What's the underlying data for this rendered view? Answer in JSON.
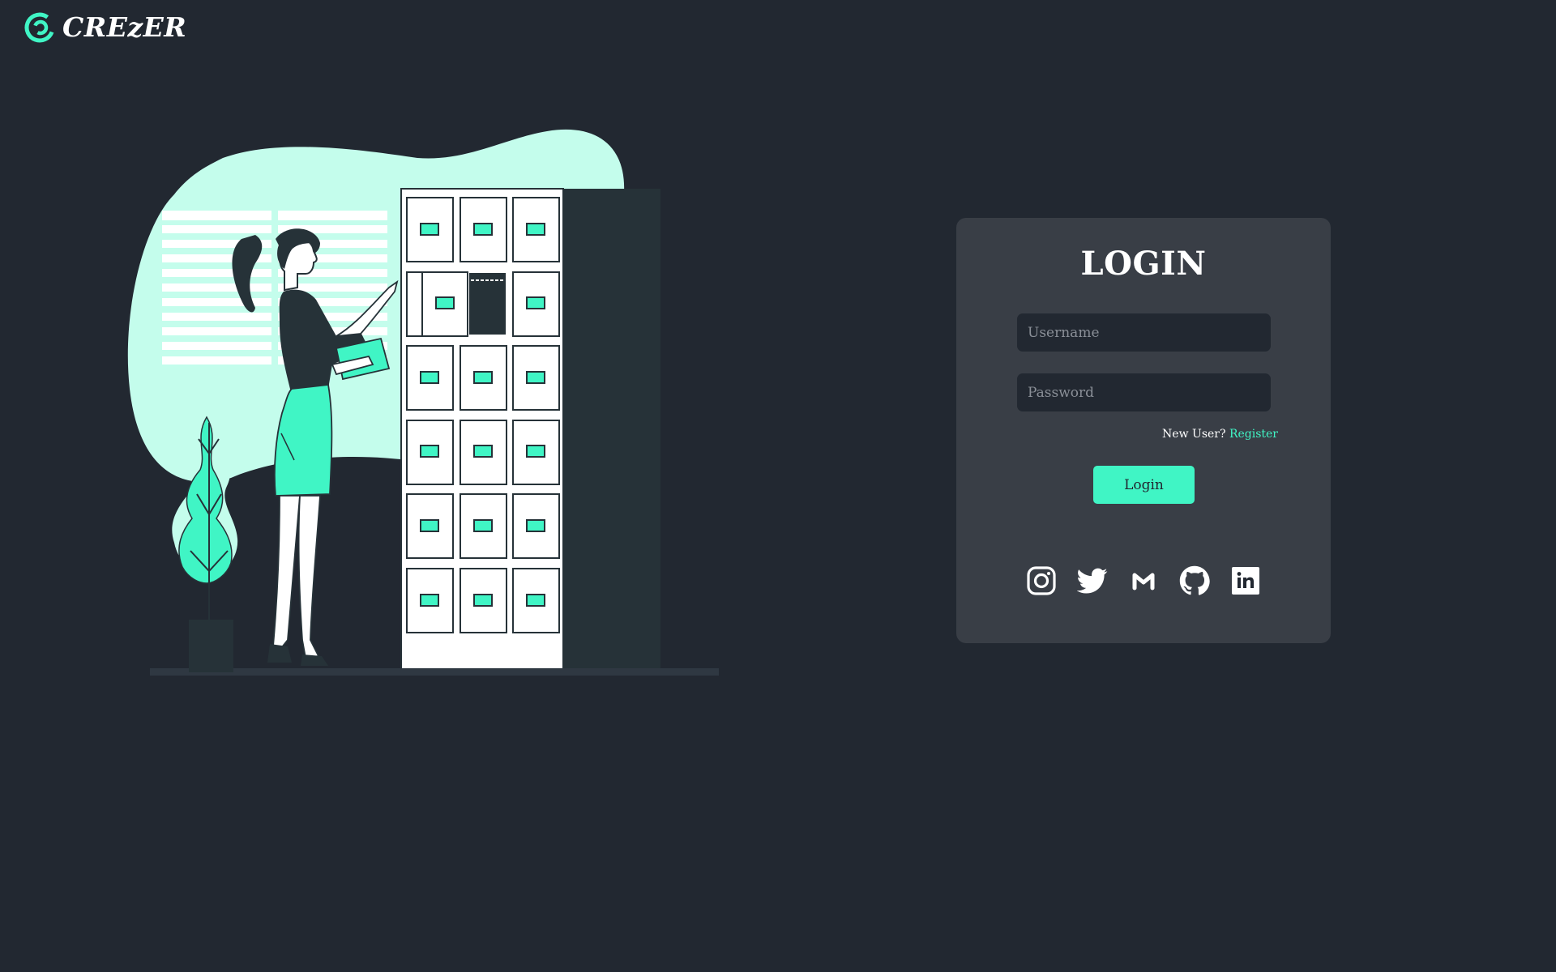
{
  "brand": {
    "name": "CREzER",
    "logo_icon": "crezer-logo-icon",
    "accent_color": "#40f5c5",
    "background_color": "#222831",
    "card_color": "#393e46"
  },
  "illustration": {
    "icon": "woman-filing-cabinet-illustration"
  },
  "login": {
    "title": "LOGIN",
    "username_placeholder": "Username",
    "password_placeholder": "Password",
    "new_user_text": "New User?",
    "register_label": "Register",
    "submit_label": "Login"
  },
  "socials": [
    {
      "icon": "instagram-icon"
    },
    {
      "icon": "twitter-icon"
    },
    {
      "icon": "gmail-icon"
    },
    {
      "icon": "github-icon"
    },
    {
      "icon": "linkedin-icon"
    }
  ]
}
